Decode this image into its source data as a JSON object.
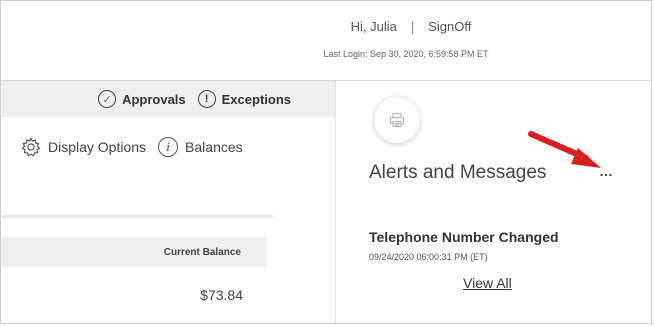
{
  "header": {
    "greeting": "Hi, Julia",
    "separator": "|",
    "signoff_label": "SignOff",
    "last_login": "Last Login: Sep 30, 2020, 6:59:58 PM ET"
  },
  "toolbar": {
    "approvals_label": "Approvals",
    "exceptions_label": "Exceptions",
    "exceptions_glyph": "!",
    "approvals_glyph": "✓"
  },
  "options": {
    "display_options_label": "Display Options",
    "balances_label": "Balances",
    "info_glyph": "i"
  },
  "balance_table": {
    "column_header": "Current Balance",
    "value": "$73.84"
  },
  "alerts": {
    "title": "Alerts and Messages",
    "more_label": "…",
    "message_title": "Telephone Number Changed",
    "message_time": "09/24/2020 06:00:31 PM (ET)",
    "view_all_label": "View All"
  },
  "colors": {
    "annotation_arrow": "#d62020",
    "toolbar_bg": "#efefef"
  },
  "icons": {
    "approvals": "check-circle-icon",
    "exceptions": "exclamation-circle-icon",
    "display_options": "gear-icon",
    "balances": "info-icon",
    "print": "printer-icon",
    "annotation": "red-arrow-icon"
  }
}
